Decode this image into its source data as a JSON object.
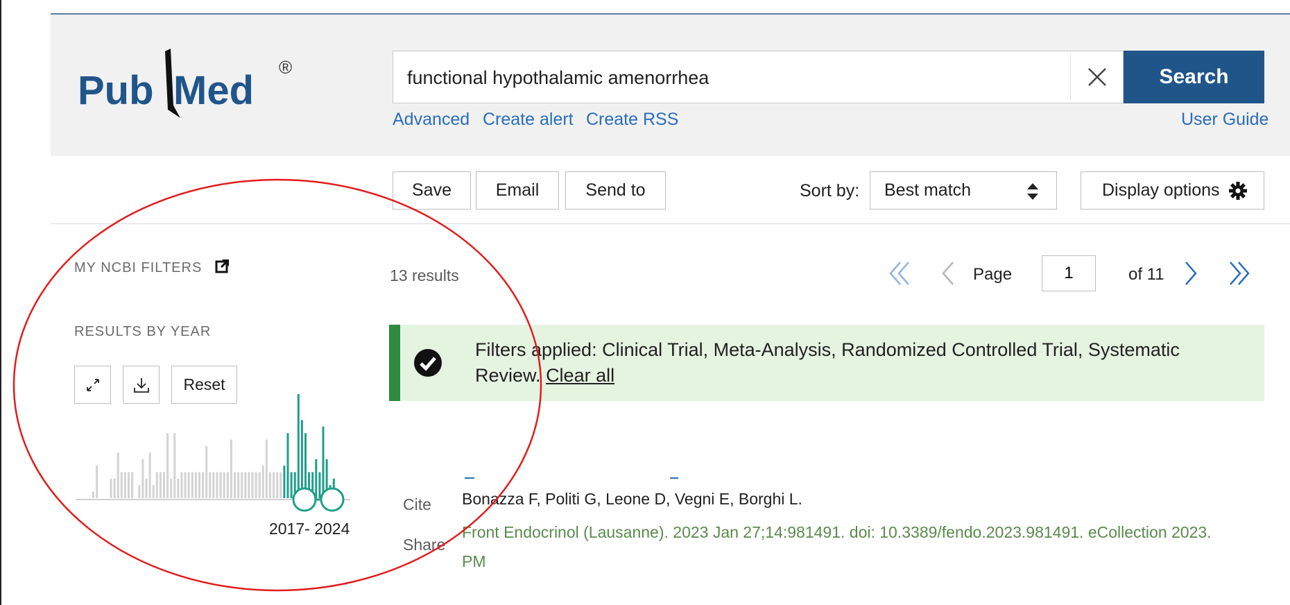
{
  "logo": {
    "part1": "Pub",
    "part2": "Med",
    "reg": "®"
  },
  "search": {
    "value": "functional hypothalamic amenorrhea",
    "button_label": "Search"
  },
  "links": {
    "advanced": "Advanced",
    "create_alert": "Create alert",
    "create_rss": "Create RSS",
    "user_guide": "User Guide"
  },
  "toolbar": {
    "save": "Save",
    "email": "Email",
    "send_to": "Send to",
    "sort_label": "Sort by:",
    "sort_value": "Best match",
    "display_options": "Display options"
  },
  "sidebar": {
    "my_ncbi_filters": "MY NCBI FILTERS",
    "results_by_year": "RESULTS BY YEAR",
    "reset": "Reset",
    "range_label": "2017- 2024",
    "histogram": [
      1,
      5,
      0,
      0,
      0,
      3,
      3,
      7,
      4,
      4,
      4,
      4,
      0,
      2,
      6,
      3,
      7,
      2,
      4,
      4,
      4,
      10,
      3,
      10,
      3,
      4,
      4,
      4,
      4,
      4,
      4,
      4,
      8,
      4,
      4,
      4,
      4,
      4,
      4,
      9,
      4,
      4,
      4,
      4,
      4,
      4,
      4,
      4,
      5,
      9,
      4,
      4,
      4,
      4,
      5,
      10,
      4,
      4,
      16,
      12,
      10,
      4,
      4,
      6,
      4,
      11,
      6,
      2,
      3
    ],
    "selected_from_index": 54
  },
  "results": {
    "count": "13 results",
    "page_label": "Page",
    "page_value": "1",
    "of_label": "of 11"
  },
  "filters": {
    "text": "Filters applied: Clinical Trial, Meta-Analysis, Randomized Controlled Trial, Systematic Review.",
    "clear_all": "Clear all"
  },
  "article": {
    "cite": "Cite",
    "share": "Share",
    "authors": "Bonazza F, Politi G, Leone D, Vegni E, Borghi L.",
    "journal": "Front Endocrinol (Lausanne). 2023 Jan 27;14:981491. doi: 10.3389/fendo.2023.981491. eCollection 2023.",
    "journal_tail": "PM"
  },
  "colors": {
    "brand_blue": "#20558a",
    "link_blue": "#2a6ebb",
    "accent_green": "#2f8b3e",
    "teal": "#1f9e89",
    "annotation_red": "#e21c1c"
  }
}
